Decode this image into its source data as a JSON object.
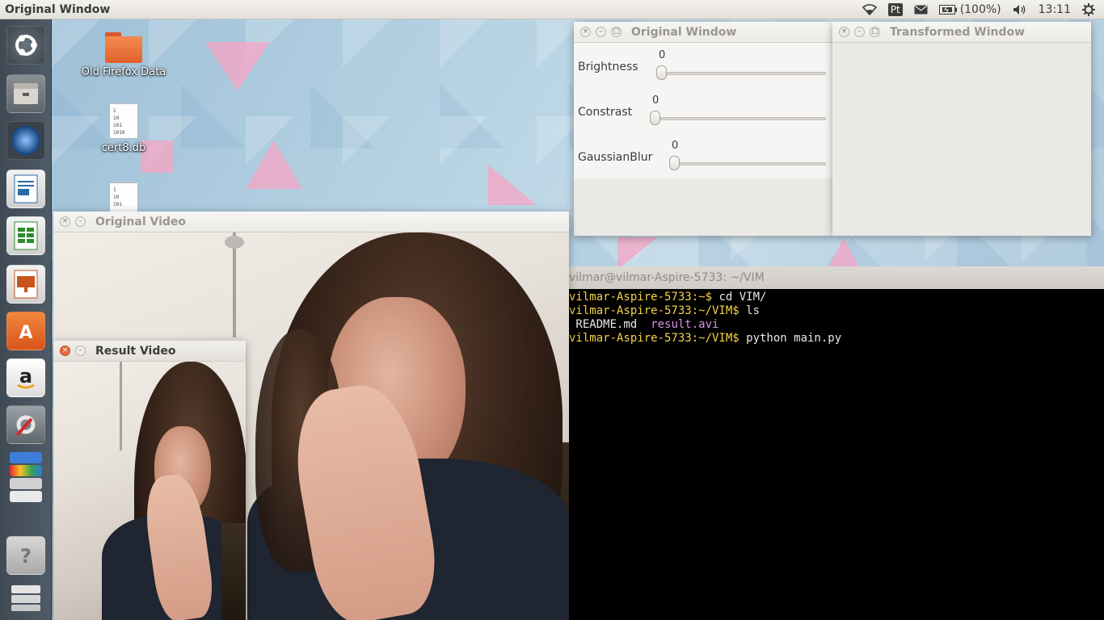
{
  "top_panel": {
    "title": "Original Window",
    "keyboard_layout": "Pt",
    "battery": "(100%)",
    "clock": "13:11"
  },
  "desktop": {
    "icons": [
      {
        "label": "Old Firefox Data",
        "icon": "folder-icon"
      },
      {
        "label": "cert8.db",
        "icon": "database-file-icon",
        "preview": "1\n10\n101\n1010"
      },
      {
        "label": "",
        "icon": "database-file-icon",
        "preview": "1\n10\n101"
      }
    ]
  },
  "launcher": {
    "items": [
      {
        "name": "ubuntu-dash-icon"
      },
      {
        "name": "files-icon"
      },
      {
        "name": "firefox-icon"
      },
      {
        "name": "libreoffice-writer-icon"
      },
      {
        "name": "libreoffice-calc-icon"
      },
      {
        "name": "libreoffice-impress-icon"
      },
      {
        "name": "software-center-icon"
      },
      {
        "name": "amazon-icon"
      },
      {
        "name": "system-settings-icon"
      },
      {
        "name": "stacked-apps-icon"
      },
      {
        "name": "help-icon"
      },
      {
        "name": "trash-icon"
      }
    ]
  },
  "original_window": {
    "title": "Original Window",
    "trackbars": [
      {
        "label": "Brightness",
        "value": "0"
      },
      {
        "label": "Constrast",
        "value": "0"
      },
      {
        "label": "GaussianBlur",
        "value": "0"
      }
    ]
  },
  "transformed_window": {
    "title": "Transformed Window"
  },
  "original_video": {
    "title": "Original Video"
  },
  "result_video": {
    "title": "Result Video"
  },
  "terminal": {
    "title": "vilmar@vilmar-Aspire-5733: ~/VIM",
    "lines": [
      {
        "prompt": "vilmar-Aspire-5733:~$",
        "command": " cd VIM/"
      },
      {
        "prompt": "vilmar-Aspire-5733:~/VIM$",
        "command": " ls"
      },
      {
        "file1": " README.md",
        "file2": "result.avi"
      },
      {
        "prompt": "vilmar-Aspire-5733:~/VIM$",
        "command": " python main.py"
      }
    ]
  },
  "colors": {
    "terminal_prompt": "#f5d34a",
    "terminal_file": "#d891e9",
    "close_button_active": "#e9683c"
  }
}
